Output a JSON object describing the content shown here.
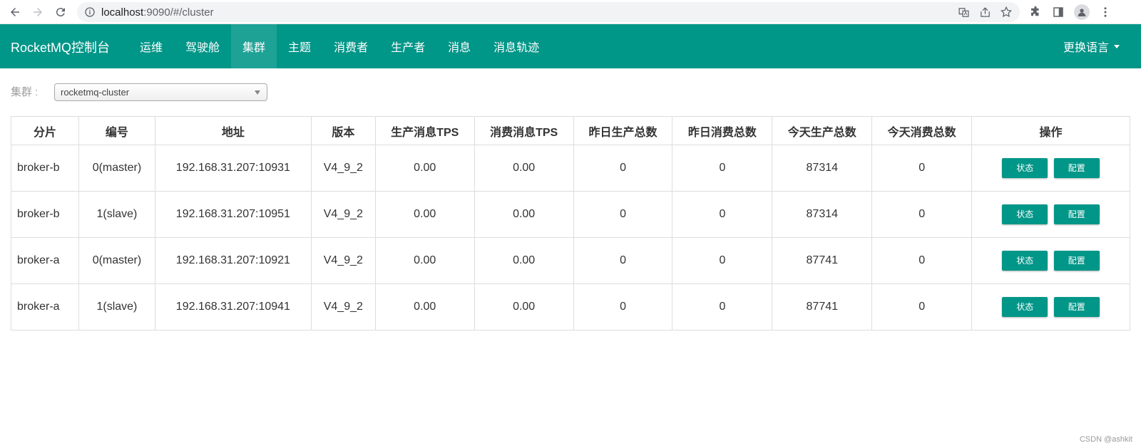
{
  "browser": {
    "url_host": "localhost",
    "url_path": ":9090/#/cluster"
  },
  "navbar": {
    "brand": "RocketMQ控制台",
    "items": [
      {
        "label": "运维",
        "active": false
      },
      {
        "label": "驾驶舱",
        "active": false
      },
      {
        "label": "集群",
        "active": true
      },
      {
        "label": "主题",
        "active": false
      },
      {
        "label": "消费者",
        "active": false
      },
      {
        "label": "生产者",
        "active": false
      },
      {
        "label": "消息",
        "active": false
      },
      {
        "label": "消息轨迹",
        "active": false
      }
    ],
    "language": "更换语言"
  },
  "filter": {
    "cluster_label": "集群 :",
    "cluster_value": "rocketmq-cluster"
  },
  "table": {
    "headers": [
      "分片",
      "编号",
      "地址",
      "版本",
      "生产消息TPS",
      "消费消息TPS",
      "昨日生产总数",
      "昨日消费总数",
      "今天生产总数",
      "今天消费总数",
      "操作"
    ],
    "rows": [
      [
        "broker-b",
        "0(master)",
        "192.168.31.207:10931",
        "V4_9_2",
        "0.00",
        "0.00",
        "0",
        "0",
        "87314",
        "0"
      ],
      [
        "broker-b",
        "1(slave)",
        "192.168.31.207:10951",
        "V4_9_2",
        "0.00",
        "0.00",
        "0",
        "0",
        "87314",
        "0"
      ],
      [
        "broker-a",
        "0(master)",
        "192.168.31.207:10921",
        "V4_9_2",
        "0.00",
        "0.00",
        "0",
        "0",
        "87741",
        "0"
      ],
      [
        "broker-a",
        "1(slave)",
        "192.168.31.207:10941",
        "V4_9_2",
        "0.00",
        "0.00",
        "0",
        "0",
        "87741",
        "0"
      ]
    ],
    "actions": {
      "status": "状态",
      "config": "配置"
    }
  },
  "watermark": "CSDN @ashkit",
  "colors": {
    "primary": "#009688"
  }
}
